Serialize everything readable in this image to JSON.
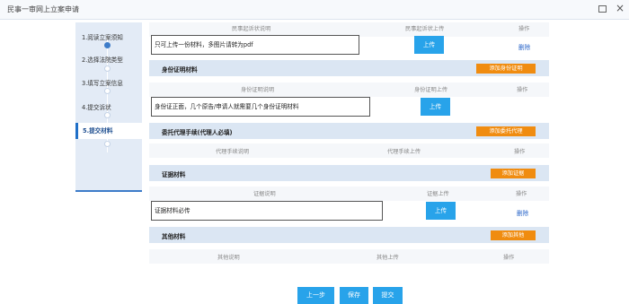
{
  "window": {
    "title": "民事一审网上立案申请"
  },
  "steps": [
    {
      "label": "1.阅读立案须知"
    },
    {
      "label": "2.选择法院类型"
    },
    {
      "label": "3.填写立案信息"
    },
    {
      "label": "4.提交诉状"
    },
    {
      "label": "5.提交材料"
    }
  ],
  "complaint": {
    "headers": {
      "desc": "民事起诉状说明",
      "upload": "民事起诉状上传",
      "op": "操作"
    },
    "input_value": "只可上传一份材料，多图片请转为pdf",
    "upload_label": "上传",
    "delete_label": "删除"
  },
  "identity": {
    "title": "身份证明材料",
    "add_label": "添加身份证明",
    "headers": {
      "desc": "身份证明说明",
      "upload": "身份证明上传",
      "op": "操作"
    },
    "input_value": "身份证正面，几个原告/申请人就需要几个身份证明材料",
    "upload_label": "上传"
  },
  "agent": {
    "title": "委托代理手续(代理人必填)",
    "add_label": "添加委托代理",
    "headers": {
      "desc": "代理手续说明",
      "upload": "代理手续上传",
      "op": "操作"
    }
  },
  "evidence": {
    "title": "证据材料",
    "add_label": "添加证据",
    "headers": {
      "desc": "证据说明",
      "upload": "证据上传",
      "op": "操作"
    },
    "input_value": "证据材料必传",
    "upload_label": "上传",
    "delete_label": "删除"
  },
  "other": {
    "title": "其他材料",
    "add_label": "添加其他",
    "headers": {
      "desc": "其他说明",
      "upload": "其他上传",
      "op": "操作"
    }
  },
  "footer": {
    "prev_label": "上一步",
    "save_label": "保存",
    "submit_label": "提交"
  }
}
